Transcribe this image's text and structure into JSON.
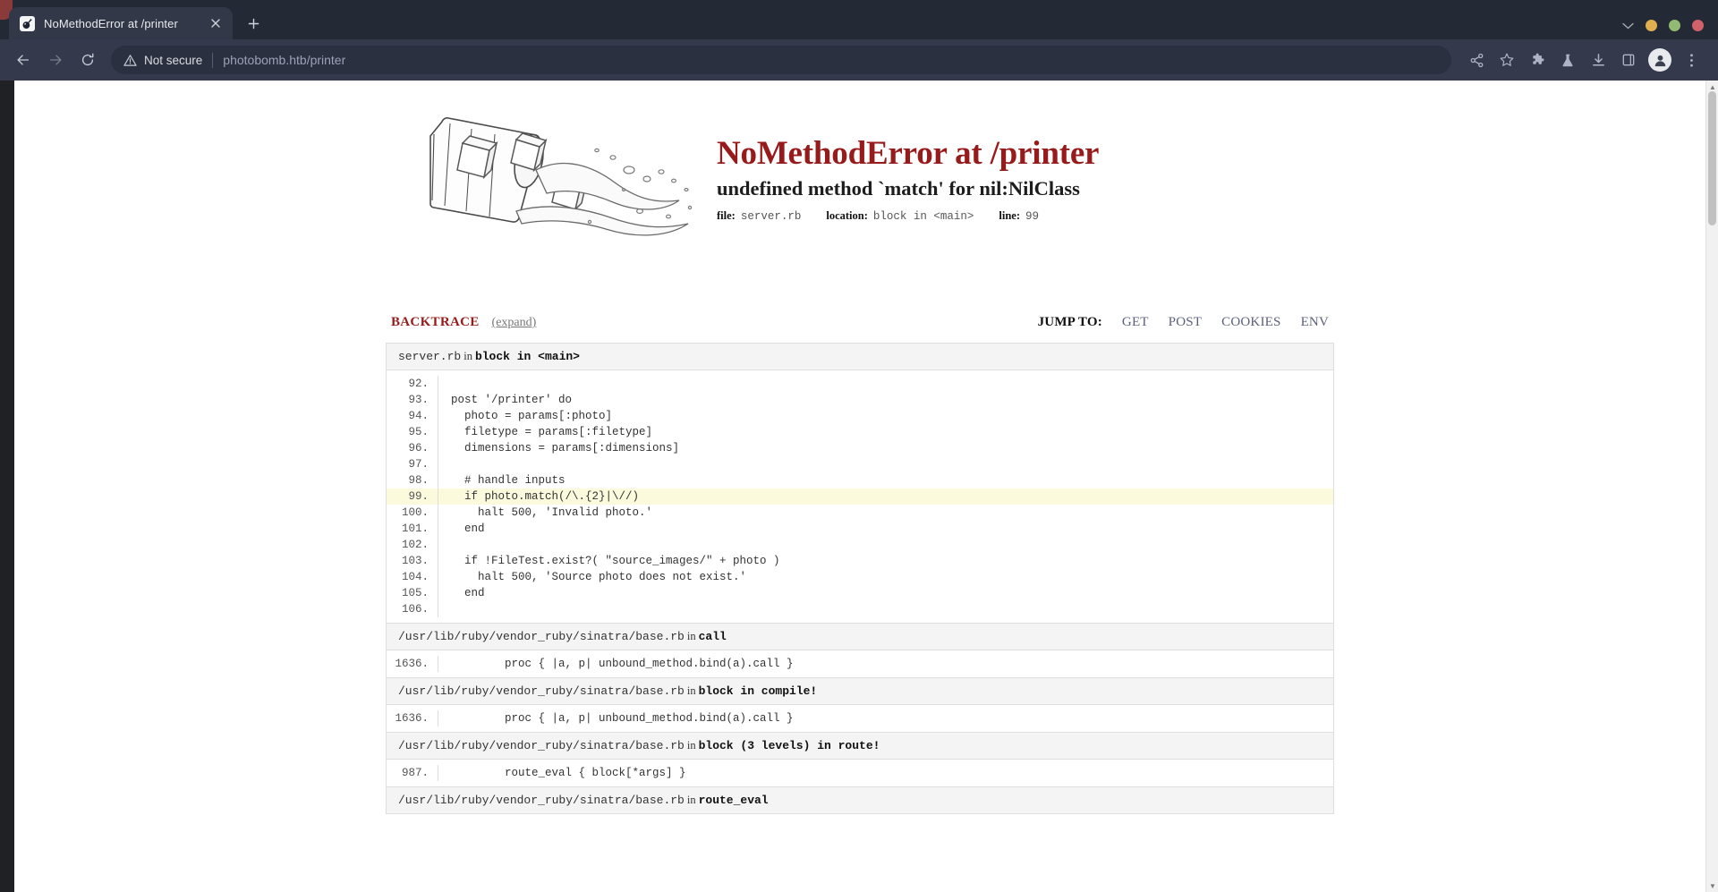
{
  "browser": {
    "tab": {
      "title": "NoMethodError at /printer",
      "favicon_icon": "bomb-icon",
      "close_icon": "close-icon"
    },
    "new_tab_icon": "plus-icon",
    "tabstrip_chevron_icon": "chevron-down-icon",
    "window_controls": {
      "minimize_color": "#e0b050",
      "maximize_color": "#93ba72",
      "close_color": "#d1626b"
    },
    "toolbar": {
      "back_icon": "back-arrow-icon",
      "forward_icon": "forward-arrow-icon",
      "reload_icon": "reload-icon",
      "security_icon": "warning-triangle-icon",
      "security_label": "Not secure",
      "url": "photobomb.htb/printer",
      "icons": [
        "share-icon",
        "bookmark-star-icon",
        "extensions-puzzle-icon",
        "experiments-flask-icon",
        "downloads-icon",
        "side-panel-icon"
      ],
      "profile_icon": "profile-avatar-icon",
      "menu_icon": "three-dot-menu-icon"
    }
  },
  "error": {
    "title": "NoMethodError at /printer",
    "subtitle": "undefined method `match' for nil:NilClass",
    "title_color": "#981b1b",
    "meta": {
      "file_key": "file:",
      "file_value": "server.rb",
      "location_key": "location:",
      "location_value": "block in <main>",
      "line_key": "line:",
      "line_value": "99"
    }
  },
  "backtrace": {
    "label": "BACKTRACE",
    "expand_label": "(expand)",
    "jump_label": "JUMP TO:",
    "jump_links": [
      "GET",
      "POST",
      "COOKIES",
      "ENV"
    ],
    "frames": [
      {
        "file": "server.rb",
        "in_word": "in",
        "function": "block in <main>",
        "lines": [
          {
            "no": "92.",
            "code": ""
          },
          {
            "no": "93.",
            "code": "post '/printer' do"
          },
          {
            "no": "94.",
            "code": "  photo = params[:photo]"
          },
          {
            "no": "95.",
            "code": "  filetype = params[:filetype]"
          },
          {
            "no": "96.",
            "code": "  dimensions = params[:dimensions]"
          },
          {
            "no": "97.",
            "code": ""
          },
          {
            "no": "98.",
            "code": "  # handle inputs"
          },
          {
            "no": "99.",
            "code": "  if photo.match(/\\.{2}|\\//)",
            "highlight": true
          },
          {
            "no": "100.",
            "code": "    halt 500, 'Invalid photo.'"
          },
          {
            "no": "101.",
            "code": "  end"
          },
          {
            "no": "102.",
            "code": ""
          },
          {
            "no": "103.",
            "code": "  if !FileTest.exist?( \"source_images/\" + photo )"
          },
          {
            "no": "104.",
            "code": "    halt 500, 'Source photo does not exist.'"
          },
          {
            "no": "105.",
            "code": "  end"
          },
          {
            "no": "106.",
            "code": ""
          }
        ]
      },
      {
        "file": "/usr/lib/ruby/vendor_ruby/sinatra/base.rb",
        "in_word": "in",
        "function": "call",
        "lines": [
          {
            "no": "1636.",
            "code": "        proc { |a, p| unbound_method.bind(a).call }"
          }
        ]
      },
      {
        "file": "/usr/lib/ruby/vendor_ruby/sinatra/base.rb",
        "in_word": "in",
        "function": "block in compile!",
        "lines": [
          {
            "no": "1636.",
            "code": "        proc { |a, p| unbound_method.bind(a).call }"
          }
        ]
      },
      {
        "file": "/usr/lib/ruby/vendor_ruby/sinatra/base.rb",
        "in_word": "in",
        "function": "block (3 levels) in route!",
        "lines": [
          {
            "no": "987.",
            "code": "        route_eval { block[*args] }"
          }
        ]
      },
      {
        "file": "/usr/lib/ruby/vendor_ruby/sinatra/base.rb",
        "in_word": "in",
        "function": "route_eval",
        "lines": []
      }
    ]
  }
}
